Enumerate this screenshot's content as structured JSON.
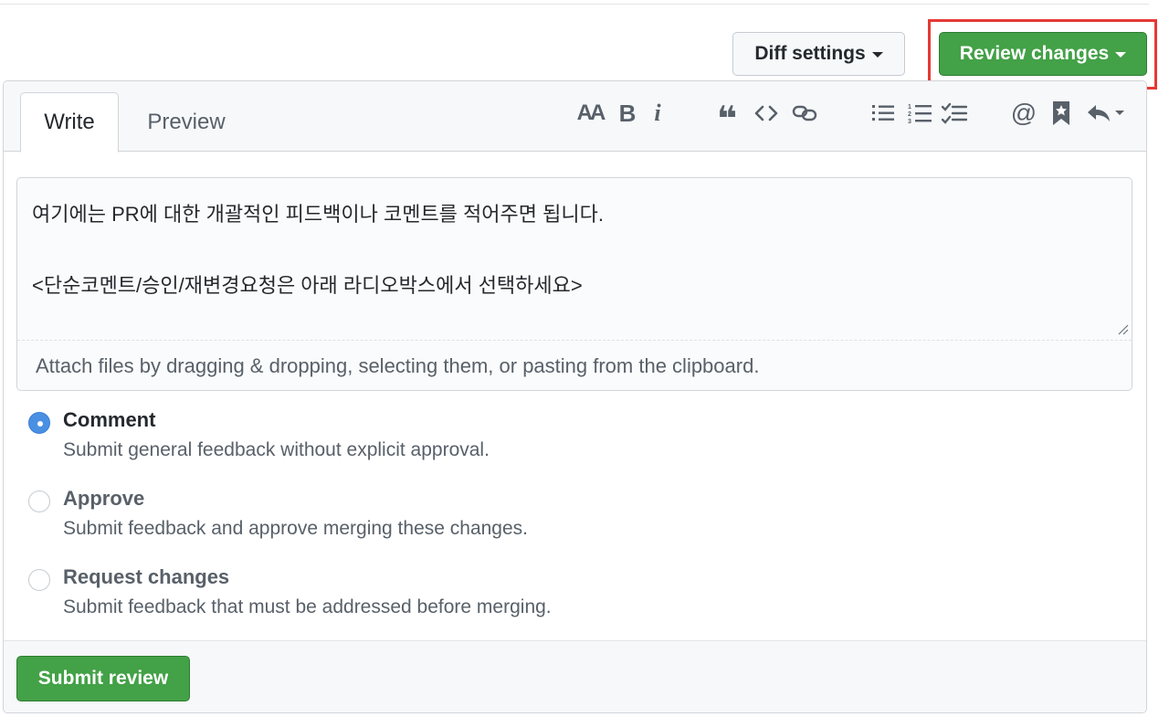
{
  "header": {
    "diff_settings_label": "Diff settings",
    "review_changes_label": "Review changes"
  },
  "tabs": {
    "write": "Write",
    "preview": "Preview"
  },
  "toolbar": {
    "icons": [
      "text-size-icon",
      "bold-icon",
      "italic-icon",
      "quote-icon",
      "code-icon",
      "link-icon",
      "unordered-list-icon",
      "ordered-list-icon",
      "task-list-icon",
      "mention-icon",
      "saved-reply-icon",
      "reply-icon"
    ],
    "text_size_glyph": "AA",
    "bold_glyph": "B",
    "italic_glyph": "i",
    "quote_glyph": "❝",
    "mention_glyph": "@"
  },
  "editor": {
    "body": "여기에는 PR에 대한 개괄적인 피드백이나 코멘트를 적어주면 됩니다.\n\n<단순코멘트/승인/재변경요청은 아래 라디오박스에서 선택하세요>",
    "attach_hint": "Attach files by dragging & dropping, selecting them, or pasting from the clipboard."
  },
  "review_options": [
    {
      "title": "Comment",
      "description": "Submit general feedback without explicit approval.",
      "checked": true
    },
    {
      "title": "Approve",
      "description": "Submit feedback and approve merging these changes.",
      "checked": false
    },
    {
      "title": "Request changes",
      "description": "Submit feedback that must be addressed before merging.",
      "checked": false
    }
  ],
  "footer": {
    "submit_label": "Submit review"
  },
  "colors": {
    "primary_green": "#43a147",
    "highlight_red": "#e53935",
    "radio_blue": "#4a90e2"
  }
}
